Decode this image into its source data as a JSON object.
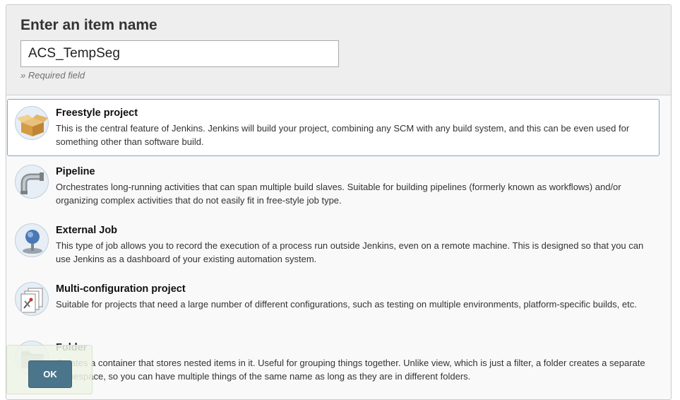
{
  "form": {
    "title": "Enter an item name",
    "item_name_value": "ACS_TempSeg",
    "required_note": "» Required field"
  },
  "items": [
    {
      "title": "Freestyle project",
      "description": "This is the central feature of Jenkins. Jenkins will build your project, combining any SCM with any build system, and this can be even used for something other than software build.",
      "icon": "cardboard-box-icon",
      "selected": true
    },
    {
      "title": "Pipeline",
      "description": "Orchestrates long-running activities that can span multiple build slaves. Suitable for building pipelines (formerly known as workflows) and/or organizing complex activities that do not easily fit in free-style job type.",
      "icon": "pipe-icon",
      "selected": false
    },
    {
      "title": "External Job",
      "description": "This type of job allows you to record the execution of a process run outside Jenkins, even on a remote machine. This is designed so that you can use Jenkins as a dashboard of your existing automation system.",
      "icon": "monitor-globe-icon",
      "selected": false
    },
    {
      "title": "Multi-configuration project",
      "description": "Suitable for projects that need a large number of different configurations, such as testing on multiple environments, platform-specific builds, etc.",
      "icon": "stacked-documents-icon",
      "selected": false
    },
    {
      "title": "Folder",
      "description": "Creates a container that stores nested items in it. Useful for grouping things together. Unlike view, which is just a filter, a folder creates a separate namespace, so you can have multiple things of the same name as long as they are in different folders.",
      "icon": "folder-icon",
      "selected": false
    }
  ],
  "actions": {
    "ok_label": "OK"
  },
  "colors": {
    "selected_border": "#7fa6c6",
    "ok_button": "#4b758b"
  }
}
